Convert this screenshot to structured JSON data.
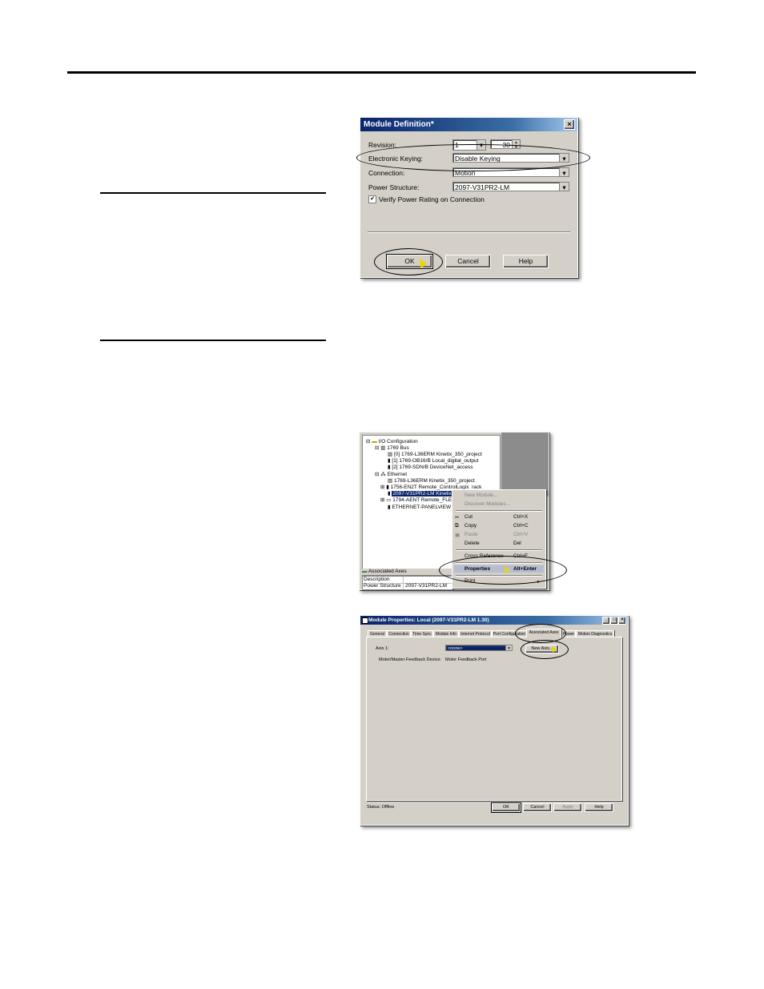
{
  "module_definition": {
    "title": "Module Definition*",
    "close": "×",
    "revision_label": "Revision:",
    "revision_major": "1",
    "revision_minor": "30",
    "keying_label": "Electronic Keying:",
    "keying_value": "Disable Keying",
    "connection_label": "Connection:",
    "connection_value": "Motion",
    "power_label": "Power Structure:",
    "power_value": "2097-V31PR2-LM",
    "verify_label": "Verify Power Rating on Connection",
    "verify_checked": "✔",
    "ok": "OK",
    "cancel": "Cancel",
    "help": "Help"
  },
  "tree": {
    "rows": [
      "I/O Configuration",
      "1769 Bus",
      "[0] 1769-L36ERM Kinetix_350_project",
      "[1] 1769-OB16/B Local_digital_output",
      "[2] 1769-SDN/B DeviceNet_access",
      "Ethernet",
      "1769-L36ERM Kinetix_350_project",
      "1756-EN2T Remote_ControlLogix_rack",
      "2097-V31PR2-LM Kinetix",
      "1794-AENT Remote_FLE",
      "ETHERNET-PANELVIEW"
    ],
    "footer_title": "Associated Axes",
    "desc_label": "Description",
    "power_label": "Power Structure",
    "power_value": "2097-V31PR2-LM"
  },
  "context_menu": {
    "new_module": "New Module...",
    "discover": "Discover Modules...",
    "cut": "Cut",
    "cut_sc": "Ctrl+X",
    "copy": "Copy",
    "copy_sc": "Ctrl+C",
    "paste": "Paste",
    "paste_sc": "Ctrl+V",
    "delete": "Delete",
    "delete_sc": "Del",
    "cross_ref": "Cross Reference",
    "cross_ref_sc": "Ctrl+E",
    "properties": "Properties",
    "properties_sc": "Alt+Enter",
    "print": "Print"
  },
  "module_properties": {
    "title": "Module Properties: Local (2097-V31PR2-LM 1.30)",
    "tabs": [
      "General",
      "Connection",
      "Time Sync",
      "Module Info",
      "Internet Protocol",
      "Port Configuration",
      "Associated Axes",
      "Power",
      "Motion Diagnostics"
    ],
    "axis_label": "Axis 1:",
    "axis_value": "<none>",
    "new_axis": "New Axis...",
    "motor_label": "Motor/Master Feedback Device:",
    "motor_value": "Motor Feedback Port",
    "status": "Status:  Offline",
    "ok": "OK",
    "cancel": "Cancel",
    "apply": "Apply",
    "help": "Help",
    "min": "_",
    "max": "□",
    "close": "×"
  }
}
